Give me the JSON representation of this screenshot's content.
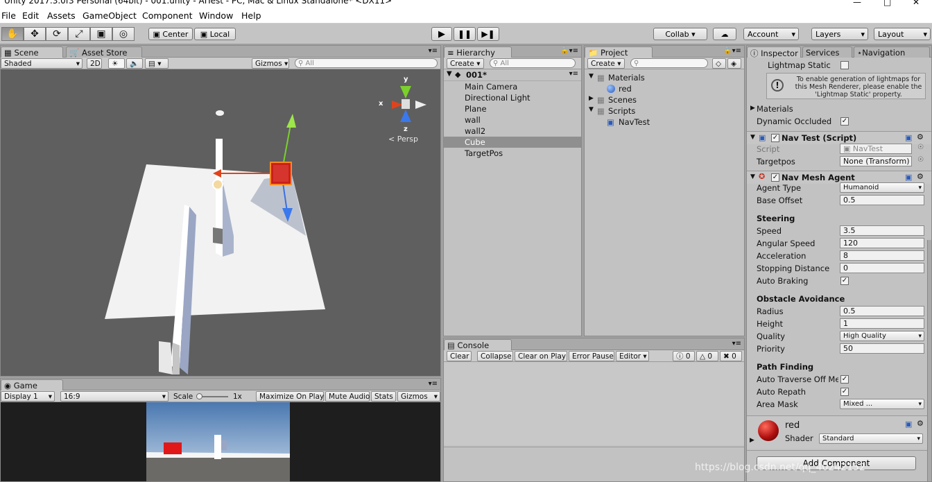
{
  "window": {
    "title": "Unity 2017.3.0f3 Personal (64bit) - 001.unity - AITest - PC, Mac & Linux Standalone* <DX11>"
  },
  "menu": [
    "File",
    "Edit",
    "Assets",
    "GameObject",
    "Component",
    "Window",
    "Help"
  ],
  "toolbar": {
    "pivot": "Center",
    "space": "Local",
    "collab": "Collab ▾",
    "account": "Account",
    "layers": "Layers",
    "layout": "Layout"
  },
  "scene": {
    "tabs": [
      "Scene",
      "Asset Store"
    ],
    "shading": "Shaded",
    "mode2d": "2D",
    "gizmos": "Gizmos",
    "search_placeholder": "All",
    "axis_x": "x",
    "axis_y": "y",
    "axis_z": "z",
    "persp": "Persp"
  },
  "game": {
    "tab": "Game",
    "display": "Display 1",
    "aspect": "16:9",
    "scale_label": "Scale",
    "scale_value": "1x",
    "maximize": "Maximize On Play",
    "mute": "Mute Audio",
    "stats": "Stats",
    "gizmos": "Gizmos"
  },
  "hierarchy": {
    "tab": "Hierarchy",
    "create": "Create",
    "search_placeholder": "All",
    "scene": "001*",
    "items": [
      "Main Camera",
      "Directional Light",
      "Plane",
      "wall",
      "wall2",
      "Cube",
      "TargetPos"
    ],
    "selected": "Cube"
  },
  "project": {
    "tab": "Project",
    "create": "Create",
    "folders": [
      "Materials",
      "red",
      "Scenes",
      "Scripts",
      "NavTest"
    ]
  },
  "console": {
    "tab": "Console",
    "clear": "Clear",
    "collapse": "Collapse",
    "clear_on_play": "Clear on Play",
    "error_pause": "Error Pause",
    "editor": "Editor",
    "count_log": "0",
    "count_warn": "0",
    "count_err": "0"
  },
  "inspector": {
    "tabs": [
      "Inspector",
      "Services",
      "Navigation"
    ],
    "lightmap_static": "Lightmap Static",
    "info": "To enable generation of lightmaps for this Mesh Renderer, please enable the 'Lightmap Static' property.",
    "materials": "Materials",
    "dynamic_occluded": "Dynamic Occluded",
    "navtest": {
      "title": "Nav Test (Script)",
      "script_label": "Script",
      "script_value": "NavTest",
      "targetpos_label": "Targetpos",
      "targetpos_value": "None (Transform)"
    },
    "agent": {
      "title": "Nav Mesh Agent",
      "agent_type_label": "Agent Type",
      "agent_type": "Humanoid",
      "base_offset_label": "Base Offset",
      "base_offset": "0.5",
      "steering": "Steering",
      "speed_label": "Speed",
      "speed": "3.5",
      "angular_label": "Angular Speed",
      "angular": "120",
      "accel_label": "Acceleration",
      "accel": "8",
      "stop_label": "Stopping Distance",
      "stop": "0",
      "braking_label": "Auto Braking",
      "obstacle": "Obstacle Avoidance",
      "radius_label": "Radius",
      "radius": "0.5",
      "height_label": "Height",
      "height": "1",
      "quality_label": "Quality",
      "quality": "High Quality",
      "priority_label": "Priority",
      "priority": "50",
      "path": "Path Finding",
      "traverse_label": "Auto Traverse Off Me",
      "repath_label": "Auto Repath",
      "area_label": "Area Mask",
      "area": "Mixed ..."
    },
    "material": {
      "name": "red",
      "shader_label": "Shader",
      "shader": "Standard"
    },
    "add_component": "Add Component"
  },
  "watermark": "https://blog.csdn.net/qq_40242152",
  "colors": {
    "accent_red": "#c8201c",
    "selection": "#8f8f8f"
  }
}
